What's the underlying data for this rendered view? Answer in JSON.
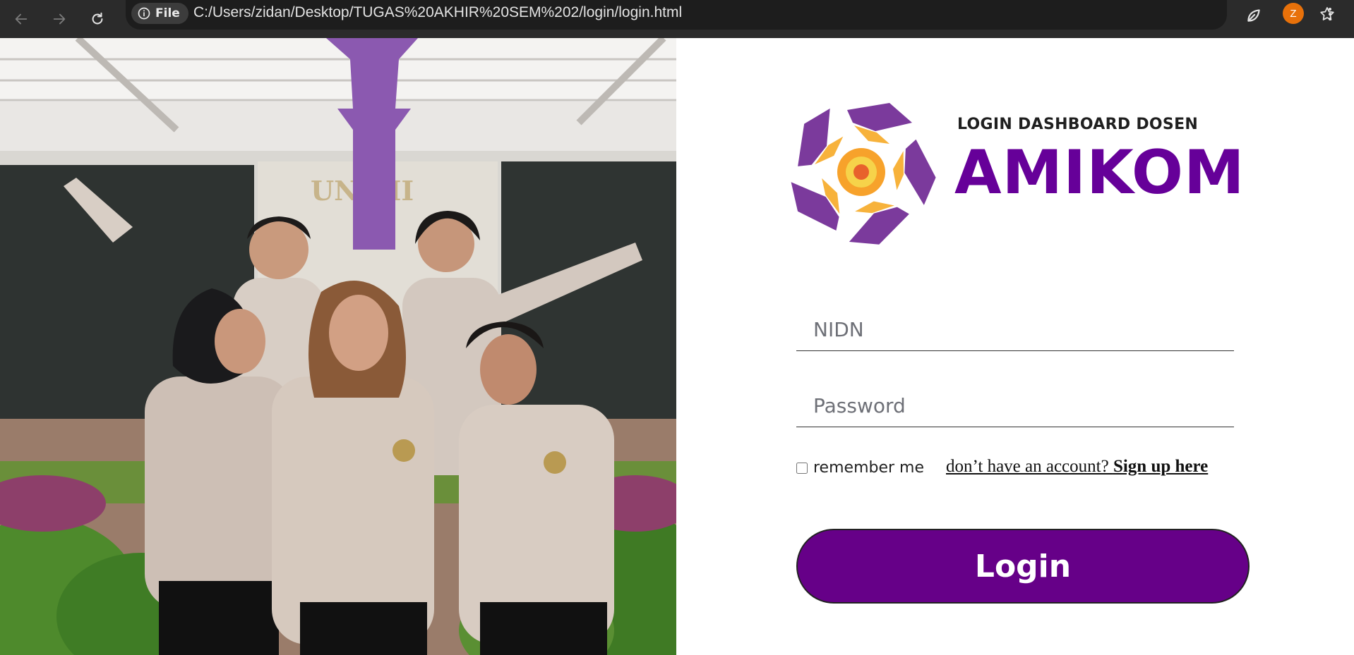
{
  "browser": {
    "site_chip_label": "File",
    "url": "C:/Users/zidan/Desktop/TUGAS%20AKHIR%20SEM%202/login/login.html",
    "avatar_letter": "Z"
  },
  "photo": {
    "sign_text": "UN  VII"
  },
  "brand": {
    "subtitle": "LOGIN DASHBOARD DOSEN",
    "name": "AMIKOM",
    "accent": "#660099"
  },
  "form": {
    "nidn_placeholder": "NIDN",
    "password_placeholder": "Password",
    "remember_label": "remember me",
    "signup_prefix": "don’t have an account? ",
    "signup_link": "Sign up here",
    "login_label": "Login"
  },
  "colors": {
    "button_bg": "#660088",
    "chrome_bg": "#2b2b2b",
    "avatar_bg": "#e8710a"
  }
}
